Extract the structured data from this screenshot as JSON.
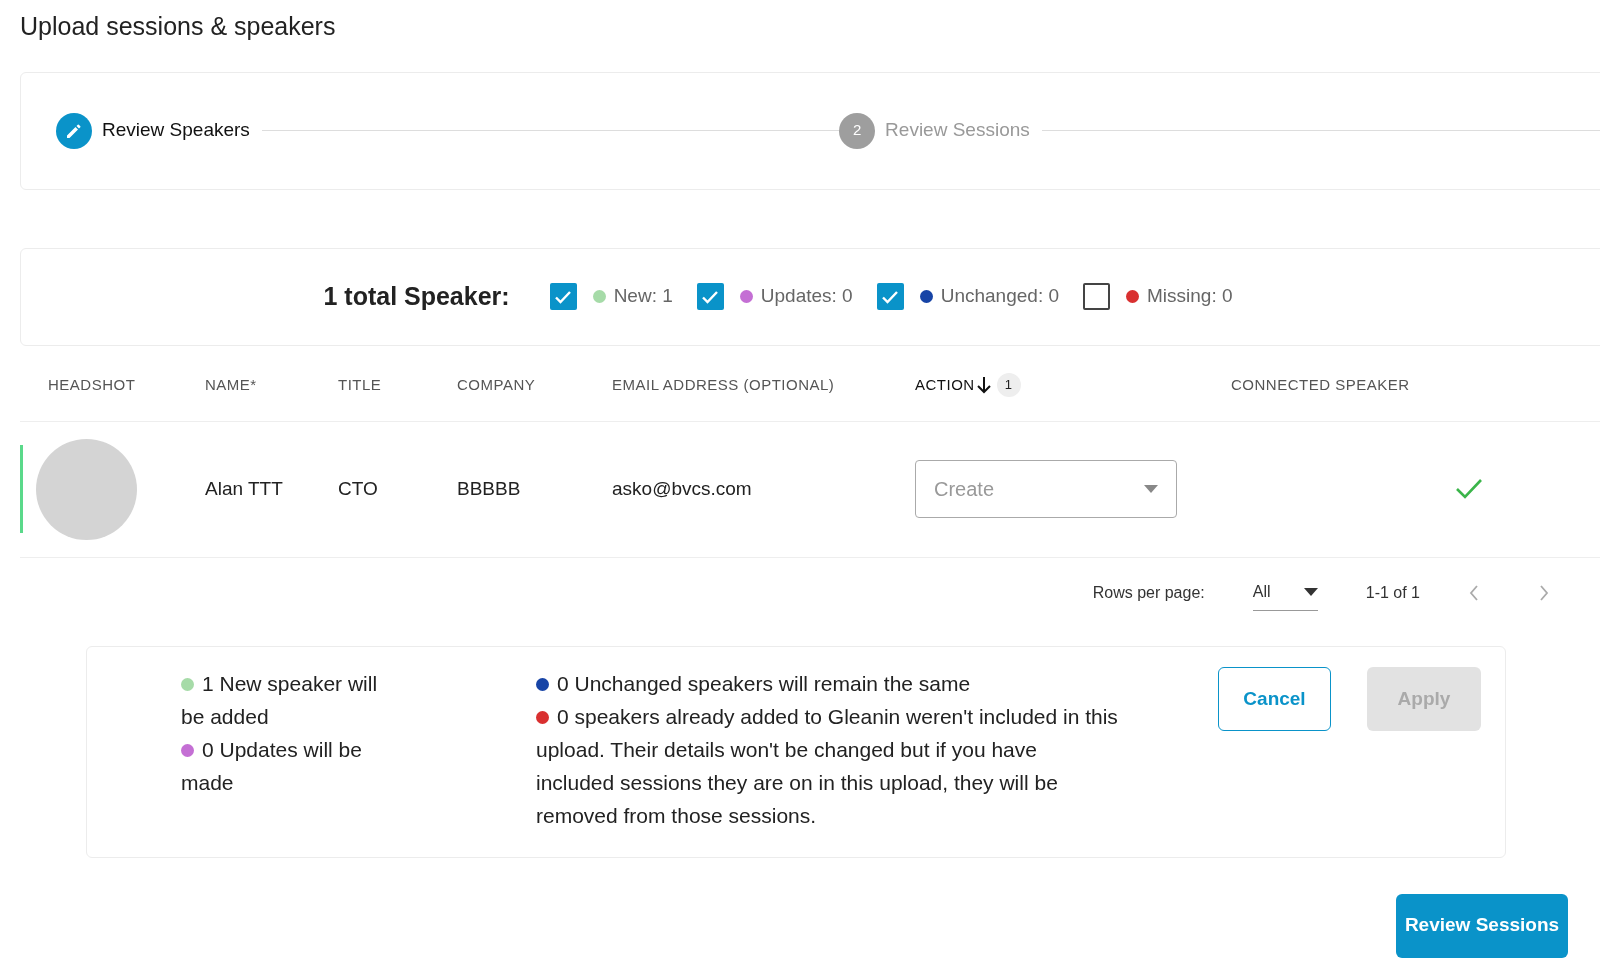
{
  "title": "Upload sessions & speakers",
  "stepper": {
    "steps": [
      {
        "label": "Review Speakers",
        "selected": true
      },
      {
        "label": "Review Sessions",
        "number": "2",
        "selected": false
      }
    ]
  },
  "filters": {
    "total": "1 total Speaker:",
    "items": [
      {
        "label": "New: 1",
        "checked": true,
        "color": "#a6dba8"
      },
      {
        "label": "Updates: 0",
        "checked": true,
        "color": "#c46fd4"
      },
      {
        "label": "Unchanged: 0",
        "checked": true,
        "color": "#1744a6"
      },
      {
        "label": "Missing: 0",
        "checked": false,
        "color": "#d93030"
      }
    ]
  },
  "table": {
    "columns": [
      {
        "label": "HEADSHOT"
      },
      {
        "label": "NAME*"
      },
      {
        "label": "TITLE"
      },
      {
        "label": "COMPANY"
      },
      {
        "label": "EMAIL ADDRESS (OPTIONAL)"
      },
      {
        "label": "ACTION",
        "sorted": true,
        "badge": "1"
      },
      {
        "label": "CONNECTED SPEAKER"
      }
    ],
    "rows": [
      {
        "name": "Alan TTT",
        "title": "CTO",
        "company": "BBBBB",
        "email": "asko@bvcs.com",
        "action": "Create",
        "connected": true,
        "color": "#5ad98a"
      }
    ]
  },
  "pagination": {
    "rows_per_page_label": "Rows per page:",
    "rows_per_page": "All",
    "range": "1-1 of 1"
  },
  "summary": {
    "left": [
      {
        "text": "1 New speaker will be added",
        "color": "#a6dba8"
      },
      {
        "text": "0 Updates will be made",
        "color": "#c46fd4"
      }
    ],
    "right": [
      {
        "text": "0 Unchanged speakers will remain the same",
        "color": "#1744a6"
      },
      {
        "text": "0 speakers already added to Gleanin weren't included in this upload. Their details won't be changed but if you have included sessions they are on in this upload, they will be removed from those sessions.",
        "color": "#d93030"
      }
    ],
    "buttons": [
      {
        "label": "Cancel",
        "kind": "outline",
        "disabled": false
      },
      {
        "label": "Apply",
        "kind": "solid",
        "disabled": true
      }
    ]
  },
  "next_button": "Review Sessions"
}
